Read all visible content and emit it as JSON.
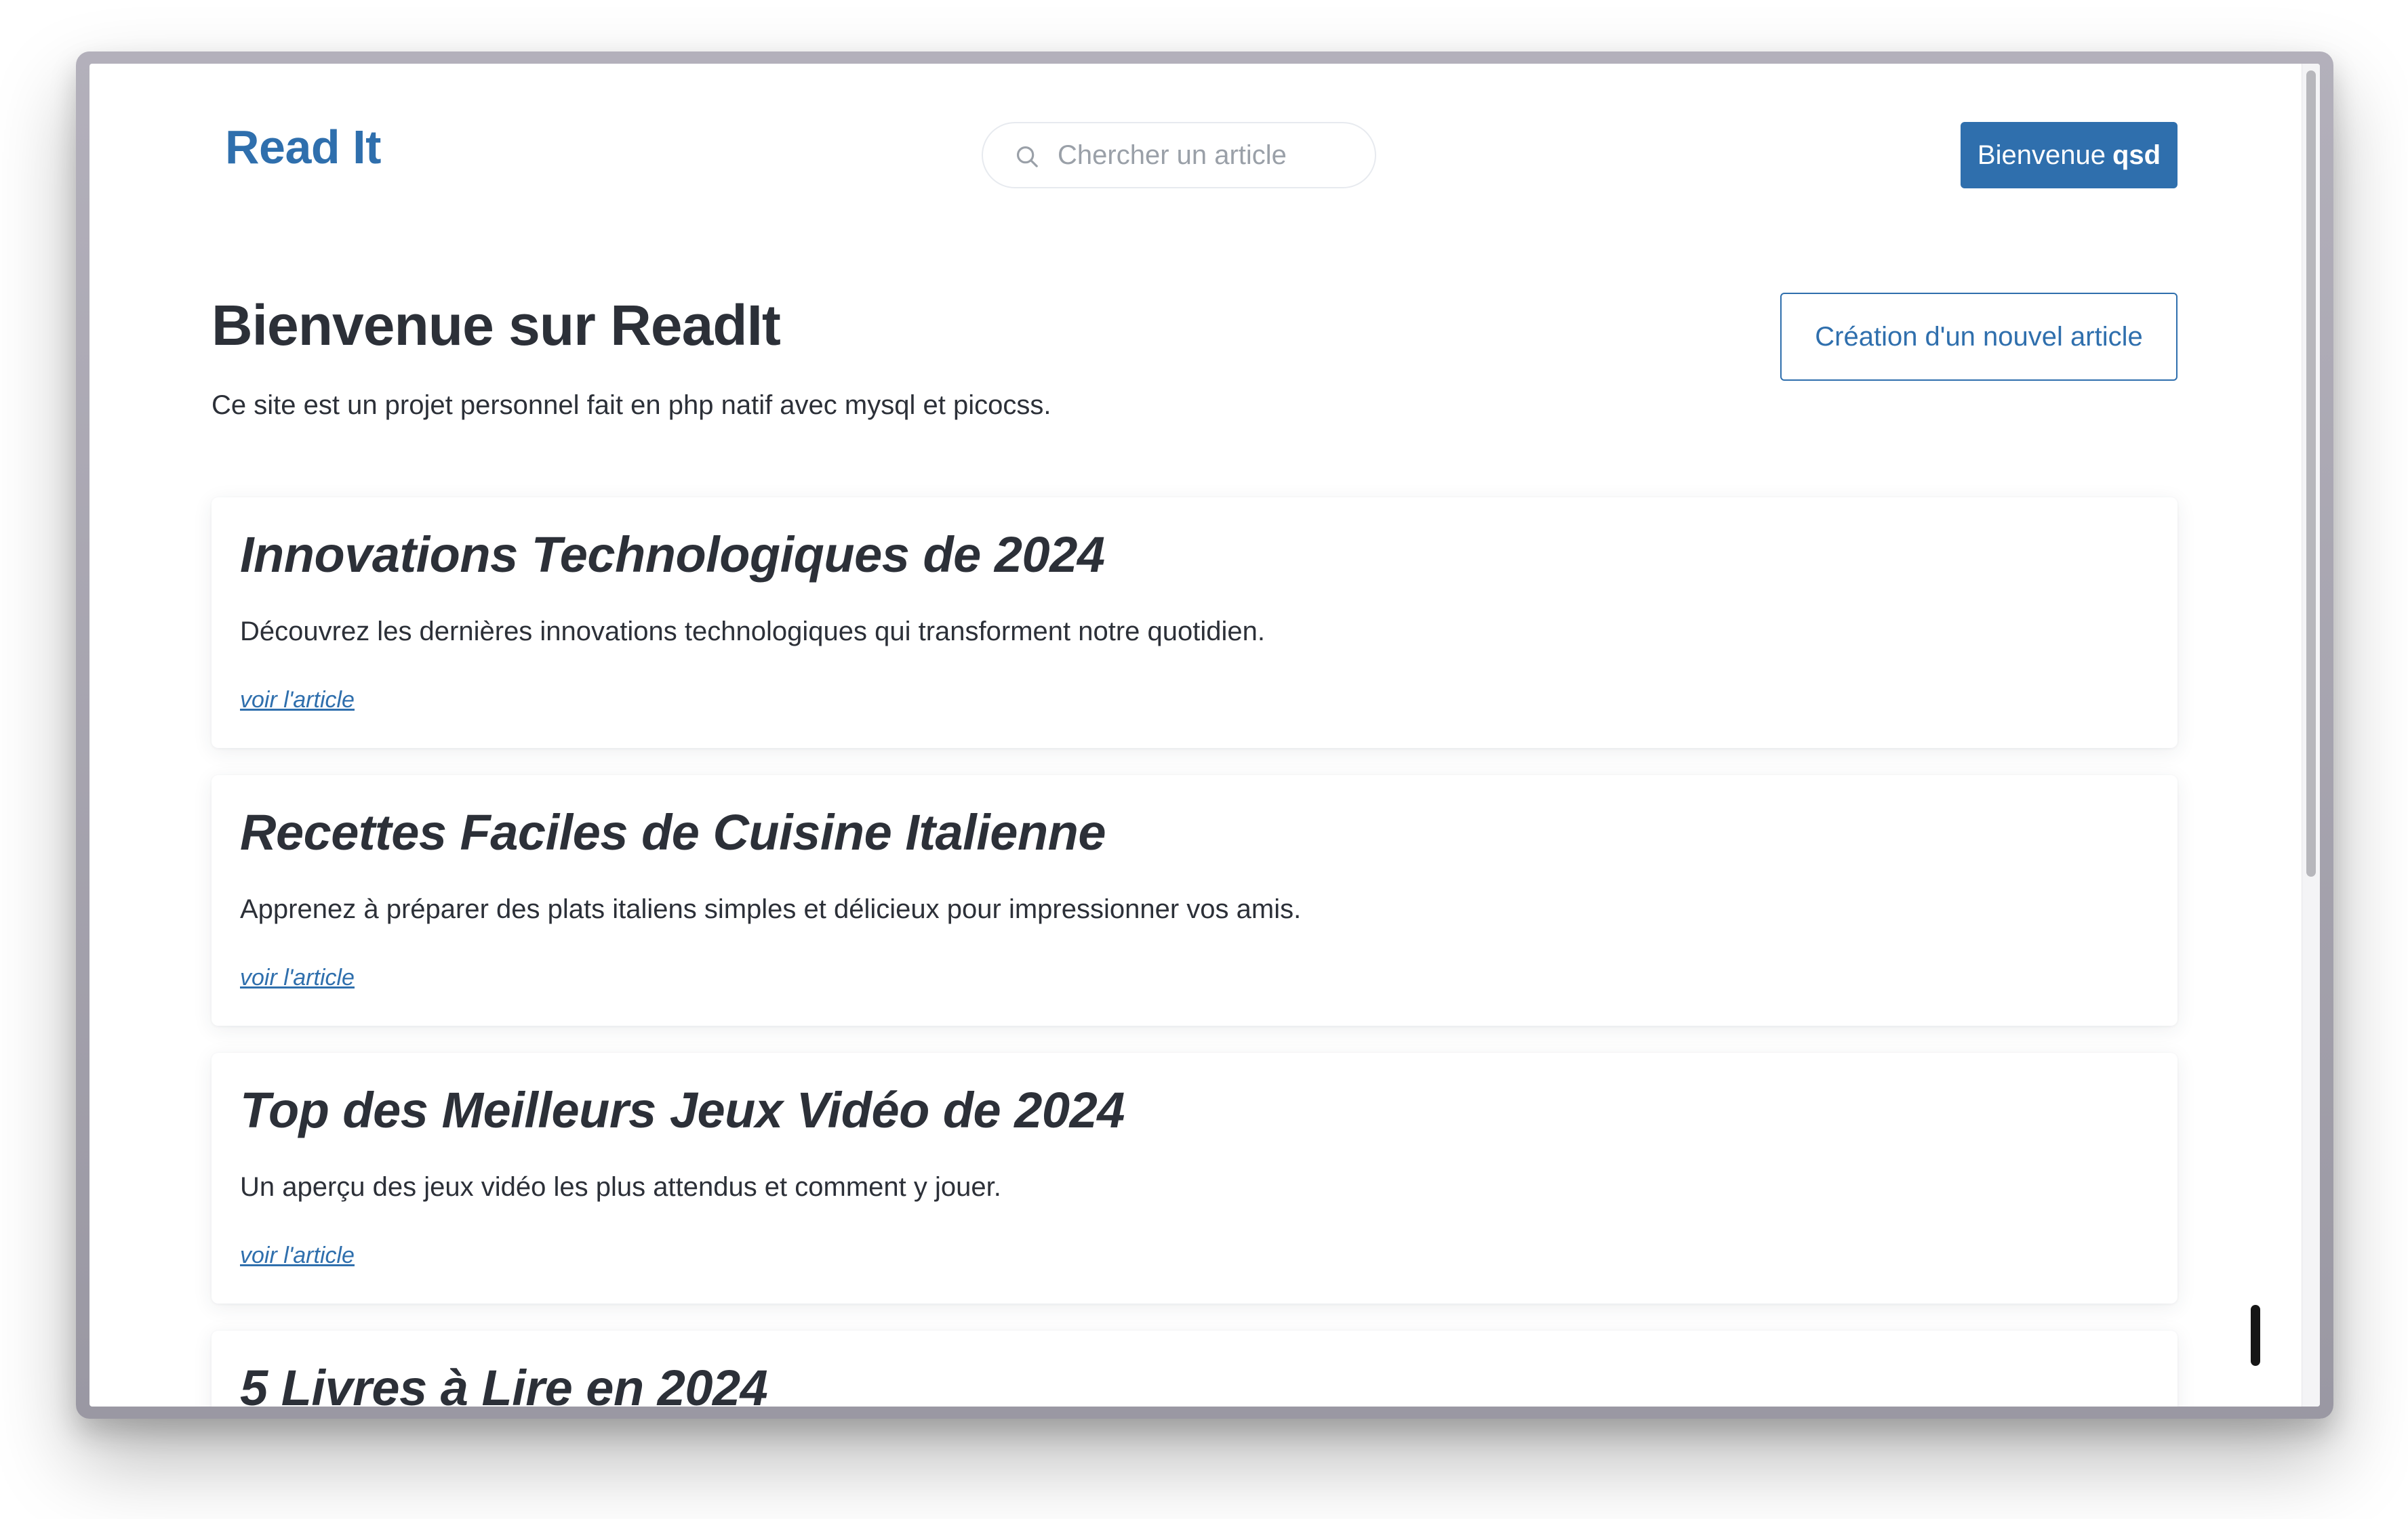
{
  "header": {
    "logo": "Read It",
    "search_placeholder": "Chercher un article",
    "welcome_prefix": "Bienvenue",
    "welcome_user": "qsd"
  },
  "hero": {
    "title": "Bienvenue sur ReadIt",
    "subtitle": "Ce site est un projet personnel fait en php natif avec mysql et picocss.",
    "new_article_label": "Création d'un nouvel article"
  },
  "articles": [
    {
      "title": "Innovations Technologiques de 2024",
      "description": "Découvrez les dernières innovations technologiques qui transforment notre quotidien.",
      "link": "voir l'article"
    },
    {
      "title": "Recettes Faciles de Cuisine Italienne",
      "description": "Apprenez à préparer des plats italiens simples et délicieux pour impressionner vos amis.",
      "link": "voir l'article"
    },
    {
      "title": "Top des Meilleurs Jeux Vidéo de 2024",
      "description": "Un aperçu des jeux vidéo les plus attendus et comment y jouer.",
      "link": "voir l'article"
    },
    {
      "title": "5 Livres à Lire en 2024",
      "description": "",
      "link": ""
    }
  ],
  "colors": {
    "primary": "#2f6fad",
    "text": "#2c3038",
    "placeholder": "#9aa0a8",
    "frame": "#a8a6b0"
  },
  "icons": {
    "search": "search-icon"
  }
}
